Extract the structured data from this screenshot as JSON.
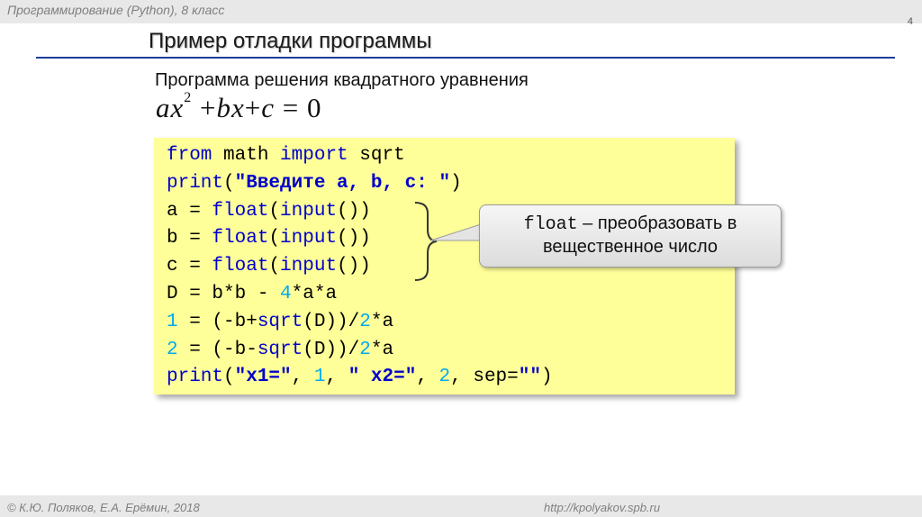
{
  "header": {
    "course": "Программирование (Python), 8 класс",
    "page_number": "4"
  },
  "slide": {
    "title": "Пример отладки программы",
    "subtitle": "Программа решения квадратного уравнения",
    "equation": {
      "a": "ax",
      "exp": "2",
      "plus1": "+",
      "b": "bx",
      "plus2": "+",
      "c": "c",
      "eq": "=",
      "zero": "0"
    }
  },
  "code": {
    "lines": [
      "from math import sqrt",
      "print(\"Введите a, b, c: \")",
      "a = float(input())",
      "b = float(input())",
      "c = float(input())",
      "D = b*b - 4*a*a",
      "x1 = (-b+sqrt(D))/2*a",
      "x2 = (-b-sqrt(D))/2*a",
      "print(\"x1=\", x1, \" x2=\", x2, sep=\"\")"
    ],
    "background": "#ffff99"
  },
  "callout": {
    "keyword": "float",
    "text_line1": " – преобразовать в",
    "text_line2": "вещественное число"
  },
  "footer": {
    "authors": "© К.Ю. Поляков, Е.А. Ерёмин, 2018",
    "url": "http://kpolyakov.spb.ru"
  },
  "colors": {
    "rule": "#1f3d99",
    "keyword": "#0000cc",
    "number": "#00aaee"
  }
}
